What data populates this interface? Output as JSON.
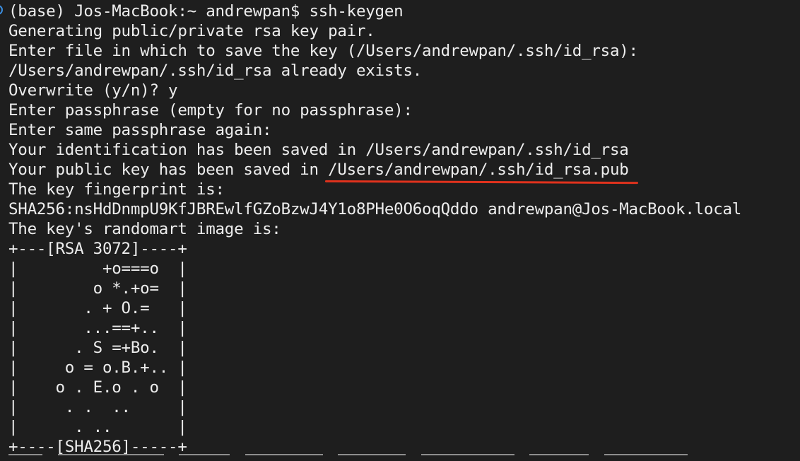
{
  "terminal": {
    "prompt_line": "(base) Jos-MacBook:~ andrewpan$ ssh-keygen",
    "lines": [
      "Generating public/private rsa key pair.",
      "Enter file in which to save the key (/Users/andrewpan/.ssh/id_rsa):",
      "/Users/andrewpan/.ssh/id_rsa already exists.",
      "Overwrite (y/n)? y",
      "Enter passphrase (empty for no passphrase):",
      "Enter same passphrase again:",
      "Your identification has been saved in /Users/andrewpan/.ssh/id_rsa"
    ],
    "public_key_prefix": "Your public key has been saved in ",
    "public_key_path": "/Users/andrewpan/.ssh/id_rsa.pub",
    "fingerprint_label": "The key fingerprint is:",
    "fingerprint": "SHA256:nsHdDnmpU9KfJBREwlfGZoBzwJ4Y1o8PHe0O6oqQddo andrewpan@Jos-MacBook.local",
    "randomart_label": "The key's randomart image is:",
    "randomart": [
      "+---[RSA 3072]----+",
      "|         +o===o  |",
      "|        o *.+o=  |",
      "|       . + O.=   |",
      "|       ...==+..  |",
      "|      . S =+Bo.  |",
      "|     o = o.B.+.. |",
      "|    o . E.o . o  |",
      "|     . .  ..     |",
      "|      . ..       |",
      "+----[SHA256]-----+"
    ],
    "colors": {
      "background": "#1e1e1e",
      "text": "#ededed",
      "highlight_underline": "#e0321d",
      "marker": "#3b8ee0"
    }
  }
}
